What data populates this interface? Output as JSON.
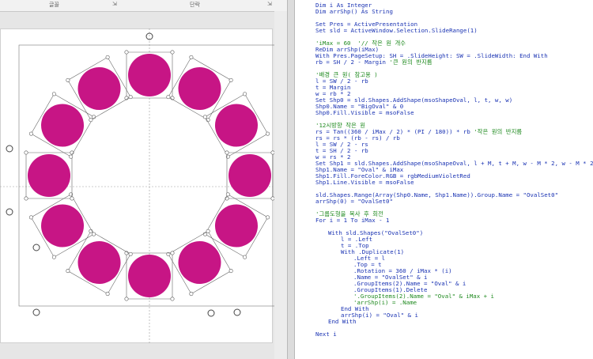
{
  "ribbon": {
    "group1": "글꼴",
    "group2": "단락",
    "launcher": "⇲"
  },
  "slide": {
    "small_circle_color": "#c71585",
    "small_circle_count": 12
  },
  "code": {
    "lines": [
      {
        "t": "Dim i As Integer",
        "c": "kw",
        "i": 0
      },
      {
        "t": "Dim arrShp() As String",
        "c": "kw",
        "i": 0
      },
      {
        "t": "",
        "c": "",
        "i": 0
      },
      {
        "t": "Set Pres = ActivePresentation",
        "c": "kw",
        "i": 0
      },
      {
        "t": "Set sld = ActiveWindow.Selection.SlideRange(1)",
        "c": "kw",
        "i": 0
      },
      {
        "t": "",
        "c": "",
        "i": 0
      },
      {
        "t": "'iMax = 60  '// 작은 원 개수",
        "c": "cm",
        "i": 0
      },
      {
        "t": "ReDim arrShp(iMax)",
        "c": "kw",
        "i": 0
      },
      {
        "t": "With Pres.PageSetup: SH = .SlideHeight: SW = .SlideWidth: End With",
        "c": "kw",
        "i": 0
      },
      {
        "t": "rb = SH / 2 - Margin '큰 원의 반지름",
        "c": "mix",
        "i": 0
      },
      {
        "t": "",
        "c": "",
        "i": 0
      },
      {
        "t": "'배경 큰 원( 참고용 )",
        "c": "cm",
        "i": 0
      },
      {
        "t": "l = SW / 2 - rb",
        "c": "kw",
        "i": 0
      },
      {
        "t": "t = Margin",
        "c": "kw",
        "i": 0
      },
      {
        "t": "w = rb * 2",
        "c": "kw",
        "i": 0
      },
      {
        "t": "Set Shp0 = sld.Shapes.AddShape(msoShapeOval, l, t, w, w)",
        "c": "kw",
        "i": 0
      },
      {
        "t": "Shp0.Name = \"BigOval\" & 0",
        "c": "kw",
        "i": 0
      },
      {
        "t": "Shp0.Fill.Visible = msoFalse",
        "c": "kw",
        "i": 0
      },
      {
        "t": "",
        "c": "",
        "i": 0
      },
      {
        "t": "'12시방향 작은 원",
        "c": "cm",
        "i": 0
      },
      {
        "t": "rs = Tan((360 / iMax / 2) * (PI / 180)) * rb '작은 원의 반지름",
        "c": "mix",
        "i": 0
      },
      {
        "t": "rs = rs * (rb - rs) / rb",
        "c": "kw",
        "i": 0
      },
      {
        "t": "l = SW / 2 - rs",
        "c": "kw",
        "i": 0
      },
      {
        "t": "t = SH / 2 - rb",
        "c": "kw",
        "i": 0
      },
      {
        "t": "w = rs * 2",
        "c": "kw",
        "i": 0
      },
      {
        "t": "Set Shp1 = sld.Shapes.AddShape(msoShapeOval, l + M, t + M, w - M * 2, w - M * 2)",
        "c": "kw",
        "i": 0
      },
      {
        "t": "Shp1.Name = \"Oval\" & iMax",
        "c": "kw",
        "i": 0
      },
      {
        "t": "Shp1.Fill.ForeColor.RGB = rgbMediumVioletRed",
        "c": "kw",
        "i": 0
      },
      {
        "t": "Shp1.Line.Visible = msoFalse",
        "c": "kw",
        "i": 0
      },
      {
        "t": "",
        "c": "",
        "i": 0
      },
      {
        "t": "sld.Shapes.Range(Array(Shp0.Name, Shp1.Name)).Group.Name = \"OvalSet0\"",
        "c": "kw",
        "i": 0
      },
      {
        "t": "arrShp(0) = \"OvalSet0\"",
        "c": "kw",
        "i": 0
      },
      {
        "t": "",
        "c": "",
        "i": 0
      },
      {
        "t": "'그룹도형을 복사 후 회전",
        "c": "cm",
        "i": 0
      },
      {
        "t": "For i = 1 To iMax - 1",
        "c": "kw",
        "i": 0
      },
      {
        "t": "",
        "c": "",
        "i": 0
      },
      {
        "t": "With sld.Shapes(\"OvalSet0\")",
        "c": "kw",
        "i": 1
      },
      {
        "t": "l = .Left",
        "c": "kw",
        "i": 2
      },
      {
        "t": "t = .Top",
        "c": "kw",
        "i": 2
      },
      {
        "t": "With .Duplicate(1)",
        "c": "kw",
        "i": 2
      },
      {
        "t": ".Left = l",
        "c": "kw",
        "i": 3
      },
      {
        "t": ".Top = t",
        "c": "kw",
        "i": 3
      },
      {
        "t": ".Rotation = 360 / iMax * (i)",
        "c": "kw",
        "i": 3
      },
      {
        "t": ".Name = \"OvalSet\" & i",
        "c": "kw",
        "i": 3
      },
      {
        "t": ".GroupItems(2).Name = \"Oval\" & i",
        "c": "kw",
        "i": 3
      },
      {
        "t": ".GroupItems(1).Delete",
        "c": "kw",
        "i": 3
      },
      {
        "t": "'.GroupItems(2).Name = \"Oval\" & iMax + i",
        "c": "cm",
        "i": 3
      },
      {
        "t": "'arrShp(i) = .Name",
        "c": "cm",
        "i": 3
      },
      {
        "t": "End With",
        "c": "kw",
        "i": 2
      },
      {
        "t": "arrShp(i) = \"Oval\" & i",
        "c": "kw",
        "i": 2
      },
      {
        "t": "End With",
        "c": "kw",
        "i": 1
      },
      {
        "t": "",
        "c": "",
        "i": 0
      },
      {
        "t": "Next i",
        "c": "kw",
        "i": 0
      }
    ]
  }
}
